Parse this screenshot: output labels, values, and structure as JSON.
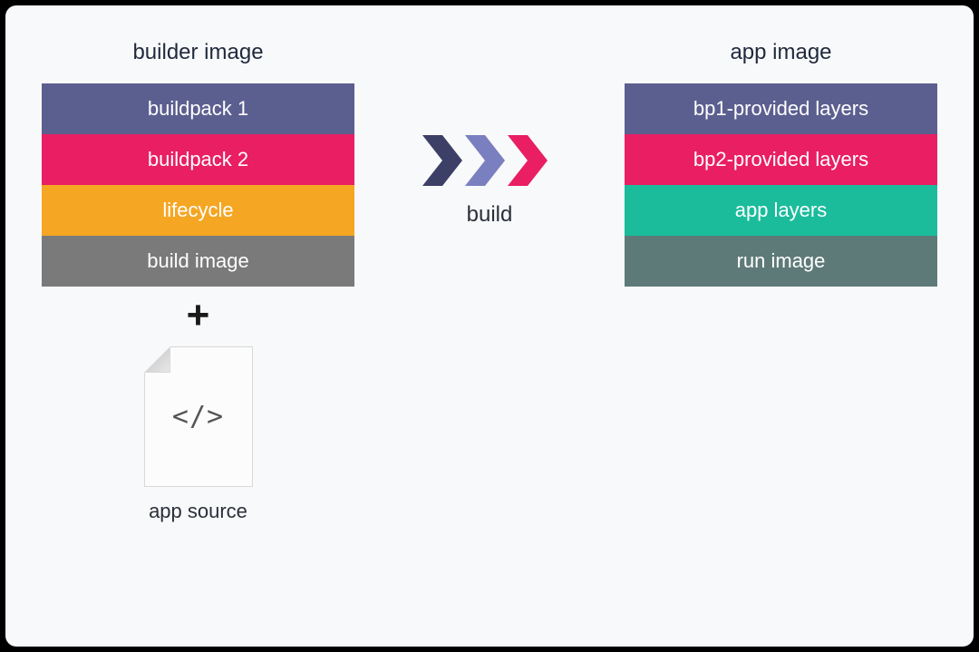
{
  "left": {
    "title": "builder image",
    "layers": [
      {
        "label": "buildpack 1",
        "color": "c-purple"
      },
      {
        "label": "buildpack 2",
        "color": "c-pink"
      },
      {
        "label": "lifecycle",
        "color": "c-orange"
      },
      {
        "label": "build image",
        "color": "c-gray"
      }
    ],
    "source_label": "app source",
    "source_glyph": "</>"
  },
  "middle": {
    "label": "build",
    "chevron_colors": [
      "#3c3f66",
      "#7a7fbf",
      "#e91e63"
    ]
  },
  "right": {
    "title": "app image",
    "layers": [
      {
        "label": "bp1-provided layers",
        "color": "c-purple"
      },
      {
        "label": "bp2-provided layers",
        "color": "c-pink"
      },
      {
        "label": "app layers",
        "color": "c-teal"
      },
      {
        "label": "run image",
        "color": "c-slate"
      }
    ]
  }
}
